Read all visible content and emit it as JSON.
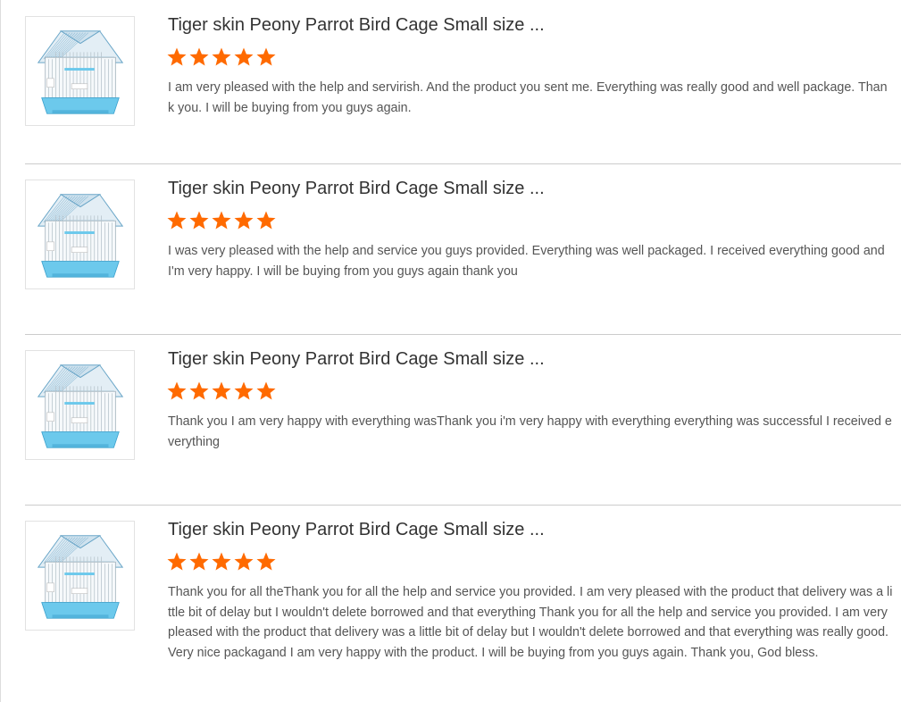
{
  "colors": {
    "star": "#ff6a00",
    "title": "#333333",
    "text": "#555555",
    "divider": "#cccccc",
    "cage_base": "#6cc9ec",
    "cage_roof": "#6aa6c8"
  },
  "icons": {
    "star": "star-icon",
    "product": "bird-cage-icon"
  },
  "reviews": [
    {
      "product_title": "Tiger skin Peony Parrot Bird Cage Small size ...",
      "rating": 5,
      "text": "I am very pleased with the help and servirish. And the product you sent me. Everything was really good and well package. Thank you. I will be buying from you guys again."
    },
    {
      "product_title": "Tiger skin Peony Parrot Bird Cage Small size ...",
      "rating": 5,
      "text": "I was very pleased with the help and service you guys provided. Everything was well packaged. I received everything good and I'm very happy. I will be buying from you guys again thank you"
    },
    {
      "product_title": "Tiger skin Peony Parrot Bird Cage Small size ...",
      "rating": 5,
      "text": "Thank you I am very happy with everything wasThank you i'm very happy with everything everything was successful I received everything"
    },
    {
      "product_title": "Tiger skin Peony Parrot Bird Cage Small size ...",
      "rating": 5,
      "text": "Thank you for all theThank you for all the help and service you provided. I am very pleased with the product that delivery was a little bit of delay but I wouldn't delete borrowed and that everything Thank you for all the help and service you provided. I am very pleased with the product that delivery was a little bit of delay but I wouldn't delete borrowed and that everything was really good. Very nice packagand I am very happy with the product. I will be buying from you guys again. Thank you, God bless."
    }
  ]
}
